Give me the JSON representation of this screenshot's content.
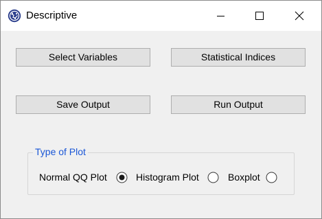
{
  "window": {
    "title": "Descriptive",
    "app_icon": "app-globe-icon",
    "controls": {
      "minimize": "minimize-icon",
      "maximize": "maximize-icon",
      "close": "close-icon"
    }
  },
  "buttons": {
    "select_variables": "Select Variables",
    "statistical_indices": "Statistical Indices",
    "save_output": "Save Output",
    "run_output": "Run Output"
  },
  "plot_group": {
    "legend": "Type of Plot",
    "options": [
      {
        "label": "Normal QQ Plot",
        "selected": true
      },
      {
        "label": "Histogram Plot",
        "selected": false
      },
      {
        "label": "Boxplot",
        "selected": false
      }
    ],
    "accent_color": "#1a56d6"
  }
}
